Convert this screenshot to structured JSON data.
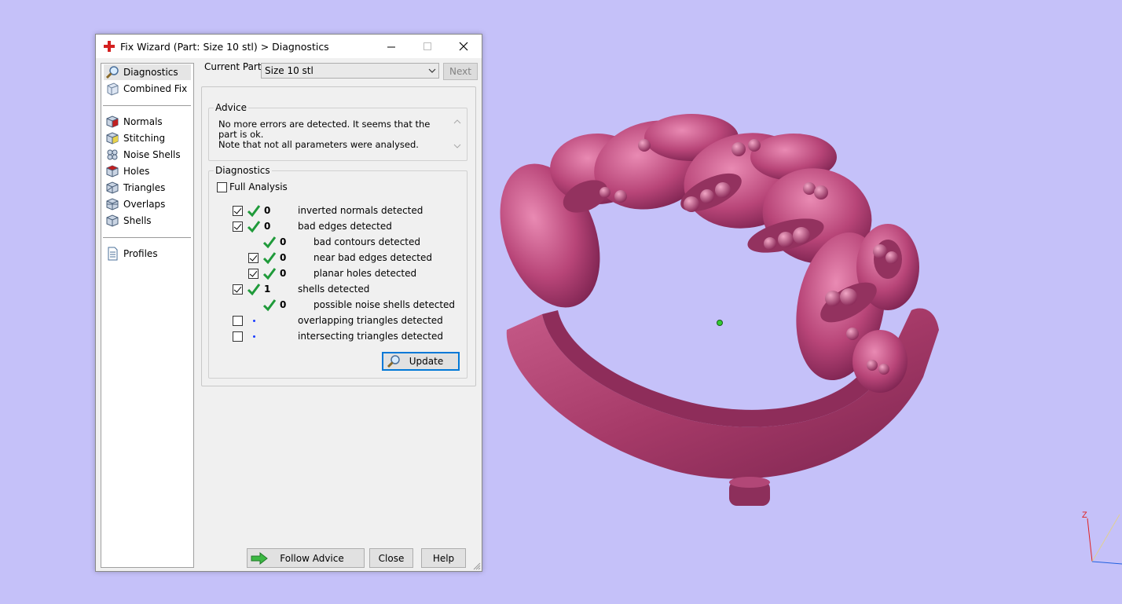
{
  "window": {
    "title": "Fix Wizard (Part: Size 10 stl) > Diagnostics"
  },
  "nav": {
    "items": [
      {
        "label": "Diagnostics",
        "icon": "magnifier-icon"
      },
      {
        "label": "Combined Fix",
        "icon": "combined-fix-icon"
      },
      {
        "label": "Normals",
        "icon": "normals-cube-icon"
      },
      {
        "label": "Stitching",
        "icon": "stitching-cube-icon"
      },
      {
        "label": "Noise Shells",
        "icon": "noise-shells-cube-icon"
      },
      {
        "label": "Holes",
        "icon": "holes-cube-icon"
      },
      {
        "label": "Triangles",
        "icon": "triangles-cube-icon"
      },
      {
        "label": "Overlaps",
        "icon": "overlaps-cube-icon"
      },
      {
        "label": "Shells",
        "icon": "shells-cube-icon"
      },
      {
        "label": "Profiles",
        "icon": "profiles-document-icon"
      }
    ]
  },
  "part": {
    "label": "Current Part:",
    "selected": "Size 10 stl",
    "next_label": "Next"
  },
  "advice": {
    "title": "Advice",
    "line1": "No more errors are detected. It seems that the part is ok.",
    "line2": "Note that not all parameters were analysed."
  },
  "diagnostics": {
    "title": "Diagnostics",
    "full_analysis_label": "Full Analysis",
    "rows": [
      {
        "value": "0",
        "label": "inverted normals detected"
      },
      {
        "value": "0",
        "label": "bad edges detected"
      },
      {
        "value": "0",
        "label": "bad contours detected"
      },
      {
        "value": "0",
        "label": "near bad edges detected"
      },
      {
        "value": "0",
        "label": "planar holes detected"
      },
      {
        "value": "1",
        "label": "shells detected"
      },
      {
        "value": "0",
        "label": "possible noise shells detected"
      },
      {
        "value": "",
        "label": "overlapping triangles detected"
      },
      {
        "value": "",
        "label": "intersecting triangles detected"
      }
    ],
    "update_label": "Update"
  },
  "footer": {
    "follow_label": "Follow Advice",
    "close_label": "Close",
    "help_label": "Help"
  },
  "axis": {
    "z_label": "Z"
  },
  "colors": {
    "viewport_bg": "#c5c1f9",
    "ring": "#b0406e",
    "check_green": "#1f9a3a"
  }
}
